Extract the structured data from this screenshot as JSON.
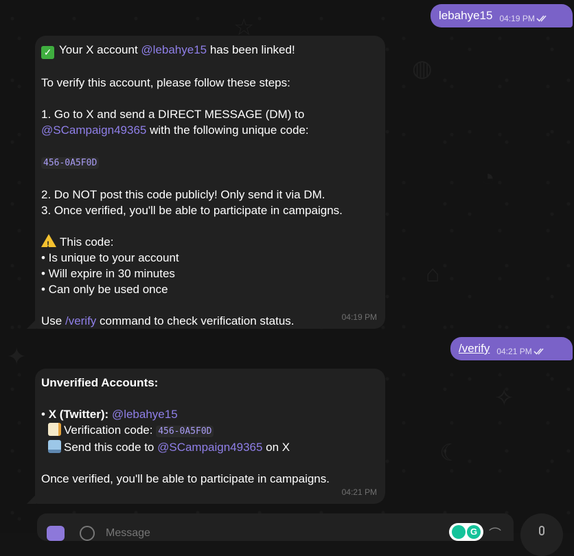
{
  "messages": {
    "out1": {
      "text": "lebahye15",
      "time": "04:19 PM"
    },
    "in1": {
      "line1_pre": "Your X account ",
      "line1_mention": "@lebahye15",
      "line1_post": " has been linked!",
      "line2": "To verify this account, please follow these steps:",
      "line3": "1. Go to X and send a DIRECT MESSAGE (DM) to",
      "line4_mention": "@SCampaign49365",
      "line4_post": " with the following unique code:",
      "code": "456-0A5F0D",
      "line5": "2. Do NOT post this code publicly! Only send it via DM.",
      "line6": "3. Once verified, you'll be able to participate in campaigns.",
      "line7": "This code:",
      "line8": "• Is unique to your account",
      "line9": "• Will expire in 30 minutes",
      "line10": "• Can only be used once",
      "line11_pre": "Use ",
      "line11_cmd": "/verify",
      "line11_post": " command to check verification status.",
      "time": "04:19 PM"
    },
    "out2": {
      "text": "/verify",
      "time": "04:21 PM"
    },
    "in2": {
      "title": "Unverified Accounts:",
      "acc_pre": "• ",
      "acc_label": "X (Twitter):",
      "acc_mention": "@lebahye15",
      "code_label": "Verification code: ",
      "code": "456-0A5F0D",
      "send_pre": "Send this code to ",
      "send_mention": "@SCampaign49365",
      "send_post": " on X",
      "footer": "Once verified, you'll be able to participate in campaigns.",
      "time": "04:21 PM"
    }
  },
  "composer": {
    "placeholder": "Message"
  },
  "icons": {
    "read_receipt": "double-check-icon",
    "emoji_check": "check-mark-emoji",
    "emoji_warning": "warning-emoji",
    "emoji_memo": "memo-emoji",
    "emoji_tray": "inbox-tray-emoji"
  },
  "colors": {
    "accent": "#7a62c8",
    "mention": "#8f7fe8",
    "bubble_in": "#212121",
    "background": "#131313"
  }
}
